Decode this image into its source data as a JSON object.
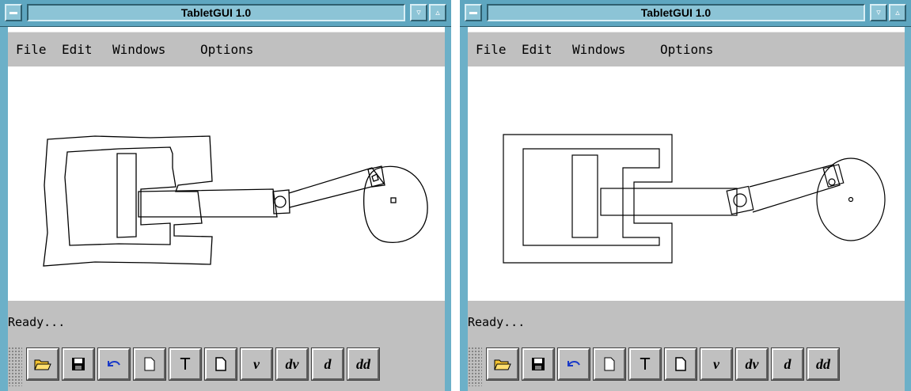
{
  "windows": [
    {
      "title": "TabletGUI 1.0",
      "menu": [
        "File",
        "Edit",
        "Windows",
        "Options"
      ],
      "status": "Ready...",
      "toolbar": [
        {
          "icon": "open-folder-icon"
        },
        {
          "icon": "save-floppy-icon"
        },
        {
          "icon": "undo-arrow-icon"
        },
        {
          "icon": "document-icon"
        },
        {
          "label": "T",
          "icon": "text-tool-icon"
        },
        {
          "icon": "new-page-icon"
        },
        {
          "label": "v"
        },
        {
          "label": "dv"
        },
        {
          "label": "d"
        },
        {
          "label": "dd"
        }
      ]
    },
    {
      "title": "TabletGUI 1.0",
      "menu": [
        "File",
        "Edit",
        "Windows",
        "Options"
      ],
      "status": "Ready...",
      "toolbar": [
        {
          "icon": "open-folder-icon"
        },
        {
          "icon": "save-floppy-icon"
        },
        {
          "icon": "undo-arrow-icon"
        },
        {
          "icon": "document-icon"
        },
        {
          "label": "T",
          "icon": "text-tool-icon"
        },
        {
          "icon": "new-page-icon"
        },
        {
          "label": "v"
        },
        {
          "label": "dv"
        },
        {
          "label": "d"
        },
        {
          "label": "dd"
        }
      ]
    }
  ],
  "colors": {
    "titlebar": "#5ea6c0",
    "window_frame": "#6cb0c8",
    "chrome": "#c0c0c0"
  }
}
